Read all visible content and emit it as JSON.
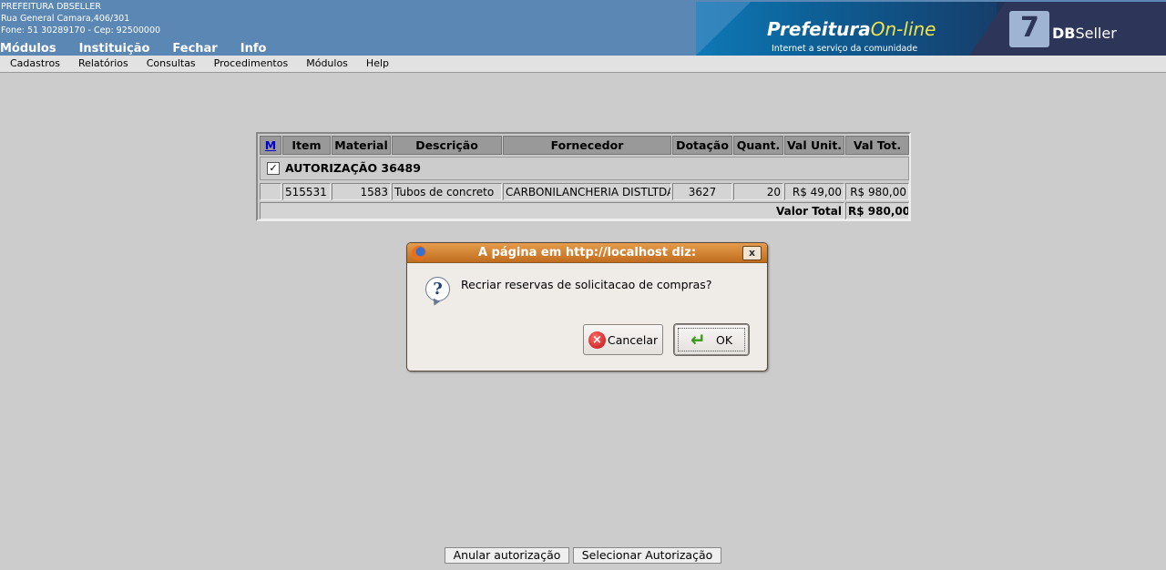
{
  "header": {
    "org_name": "PREFEITURA DBSELLER",
    "org_address": "Rua General Camara,406/301",
    "org_contact": "Fone: 51 30289170  -  Cep: 92500000",
    "top_menu": [
      "Módulos",
      "Instituição",
      "Fechar",
      "Info"
    ],
    "banner_title_a": "Prefeitura",
    "banner_title_b": "On-line",
    "banner_subtitle": "Internet a serviço da comunidade",
    "dbseller_a": "DB",
    "dbseller_b": "Seller"
  },
  "menubar": [
    "Cadastros",
    "Relatórios",
    "Consultas",
    "Procedimentos",
    "Módulos",
    "Help"
  ],
  "table": {
    "headers": {
      "mark": "M",
      "item": "Item",
      "material": "Material",
      "descricao": "Descrição",
      "fornecedor": "Fornecedor",
      "dotacao": "Dotação",
      "quant": "Quant.",
      "val_unit": "Val Unit.",
      "val_tot": "Val Tot."
    },
    "authorization_label": "AUTORIZAÇÃO 36489",
    "authorization_checked": "✓",
    "row": {
      "item": "515531",
      "material": "1583",
      "descricao": "Tubos de concreto",
      "fornecedor": "CARBONILANCHERIA DISTLTDA",
      "dotacao": "3627",
      "quant": "20",
      "val_unit": "R$ 49,00",
      "val_tot": "R$ 980,00"
    },
    "total_label": "Valor Total",
    "total_value": "R$ 980,00"
  },
  "dialog": {
    "title": "A página em http://localhost diz:",
    "close": "x",
    "message": "Recriar reservas de solicitacao de compras?",
    "cancel_label": "Cancelar",
    "ok_label": "OK"
  },
  "bottom_buttons": {
    "anular": "Anular autorização",
    "selecionar": "Selecionar Autorização"
  }
}
